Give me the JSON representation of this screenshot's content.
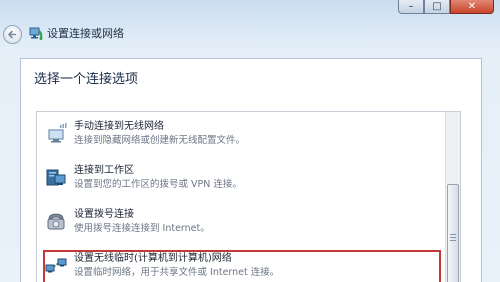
{
  "window": {
    "title": "设置连接或网络",
    "controls": {
      "minimize": "–",
      "maximize": "□",
      "close": "✕"
    }
  },
  "main": {
    "heading": "选择一个连接选项",
    "options": [
      {
        "icon": "wireless-network-icon",
        "title": "手动连接到无线网络",
        "description": "连接到隐藏网络或创建新无线配置文件。",
        "selected": false
      },
      {
        "icon": "workplace-computer-icon",
        "title": "连接到工作区",
        "description": "设置到您的工作区的拨号或 VPN 连接。",
        "selected": false
      },
      {
        "icon": "dialup-phone-icon",
        "title": "设置拨号连接",
        "description": "使用拨号连接连接到 Internet。",
        "selected": false
      },
      {
        "icon": "adhoc-network-icon",
        "title": "设置无线临时(计算机到计算机)网络",
        "description": "设置临时网络，用于共享文件或 Internet 连接。",
        "selected": true
      }
    ]
  },
  "colors": {
    "selection_border": "#c23a35",
    "heading_text": "#1b2a48",
    "description_text": "#6b7585"
  }
}
